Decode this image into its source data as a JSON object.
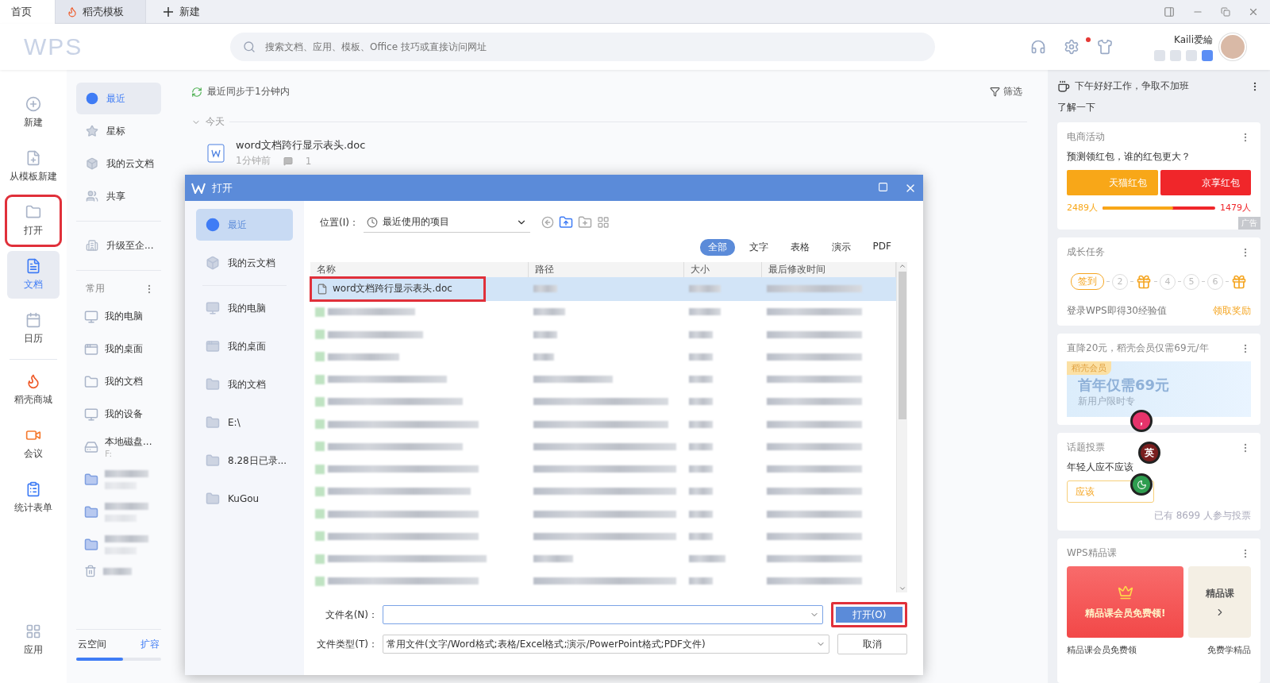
{
  "tabs": [
    {
      "label": "首页",
      "selected": true
    },
    {
      "label": "稻壳模板",
      "selected": false
    }
  ],
  "new_tab": "新建",
  "logo": "WPS",
  "search": {
    "placeholder": "搜索文档、应用、模板、Office 技巧或直接访问网址"
  },
  "user": {
    "name": "Kaili爱綸"
  },
  "rail": [
    {
      "label": "新建",
      "selected": false,
      "highlighted": false
    },
    {
      "label": "从模板新建",
      "selected": false,
      "highlighted": false
    },
    {
      "label": "打开",
      "selected": false,
      "highlighted": true
    },
    {
      "label": "文档",
      "selected": true,
      "highlighted": false
    },
    {
      "label": "日历",
      "selected": false,
      "highlighted": false
    },
    {
      "label": "稻壳商城",
      "selected": false,
      "highlighted": false
    },
    {
      "label": "会议",
      "selected": false,
      "highlighted": false
    },
    {
      "label": "统计表单",
      "selected": false,
      "highlighted": false
    }
  ],
  "rail_bottom": "应用",
  "nav": {
    "items": [
      {
        "label": "最近",
        "selected": true
      },
      {
        "label": "星标",
        "selected": false
      },
      {
        "label": "我的云文档",
        "selected": false
      },
      {
        "label": "共享",
        "selected": false
      }
    ],
    "upgrade": "升级至企...",
    "section": "常用",
    "places": [
      {
        "label": "我的电脑"
      },
      {
        "label": "我的桌面"
      },
      {
        "label": "我的文档"
      },
      {
        "label": "我的设备"
      },
      {
        "label": "本地磁盘...",
        "sub": "F:"
      }
    ],
    "storage": {
      "label": "云空间",
      "action": "扩容",
      "level": 0.55
    }
  },
  "main": {
    "sync": "最近同步于1分钟内",
    "filter": "筛选",
    "group": "今天",
    "file": {
      "name": "word文档跨行显示表头.doc",
      "time": "1分钟前",
      "comments": "1"
    }
  },
  "dialog": {
    "title": "打开",
    "nav": [
      {
        "label": "最近",
        "selected": true
      },
      {
        "label": "我的云文档",
        "selected": false
      },
      {
        "label": "我的电脑",
        "selected": false
      },
      {
        "label": "我的桌面",
        "selected": false
      },
      {
        "label": "我的文档",
        "selected": false
      },
      {
        "label": "E:\\",
        "selected": false
      },
      {
        "label": "8.28日已录...",
        "selected": false
      },
      {
        "label": "KuGou",
        "selected": false
      }
    ],
    "location_label": "位置(I)：",
    "location": "最近使用的项目",
    "types": [
      {
        "label": "全部",
        "selected": true
      },
      {
        "label": "文字",
        "selected": false
      },
      {
        "label": "表格",
        "selected": false
      },
      {
        "label": "演示",
        "selected": false
      },
      {
        "label": "PDF",
        "selected": false
      }
    ],
    "columns": [
      "名称",
      "路径",
      "大小",
      "最后修改时间"
    ],
    "files": [
      {
        "name": "word文档跨行显示表头.doc",
        "selected": true,
        "highlighted": true
      }
    ],
    "filename_label": "文件名(N)：",
    "filetype_label": "文件类型(T)：",
    "filetype": "常用文件(文字/Word格式;表格/Excel格式;演示/PowerPoint格式;PDF文件)",
    "buttons": [
      {
        "label": "打开(O)",
        "kind": "primary",
        "highlighted": true
      },
      {
        "label": "取消",
        "kind": "secondary",
        "highlighted": false
      }
    ]
  },
  "right_panel": {
    "greeting": "下午好好工作，争取不加班",
    "section": "了解一下",
    "cards": [
      {
        "kind": "ecommerce",
        "title": "电商活动",
        "text": "预测领红包，谁的红包更大？",
        "left": "天猫红包",
        "right": "京享红包",
        "left_count": "2489人",
        "right_count": "1479人",
        "level": 0.63,
        "ad": "广告"
      },
      {
        "kind": "tasks",
        "title": "成长任务",
        "steps": [
          {
            "kind": "checkin",
            "label": "签到"
          },
          {
            "kind": "day",
            "label": "2"
          },
          {
            "kind": "gift"
          },
          {
            "kind": "day",
            "label": "4"
          },
          {
            "kind": "day",
            "label": "5"
          },
          {
            "kind": "day",
            "label": "6"
          },
          {
            "kind": "gift"
          }
        ],
        "text": "登录WPS即得30经验值",
        "action": "领取奖励"
      },
      {
        "kind": "promo",
        "title": "直降20元，稻壳会员仅需69元/年",
        "tag": "稻壳会员",
        "headline": "首年仅需69元",
        "sub": "新用户限时专"
      },
      {
        "kind": "vote",
        "title": "话题投票",
        "text": "年轻人应不应该",
        "option": "应该",
        "count": "已有 8699 人参与投票"
      },
      {
        "kind": "course",
        "title": "WPS精品课",
        "banner": "精品课会员免费领!",
        "banner2": "精品课",
        "caption": "精品课会员免费领",
        "caption2": "免费学精品"
      }
    ]
  },
  "ime": [
    "，",
    "英"
  ]
}
